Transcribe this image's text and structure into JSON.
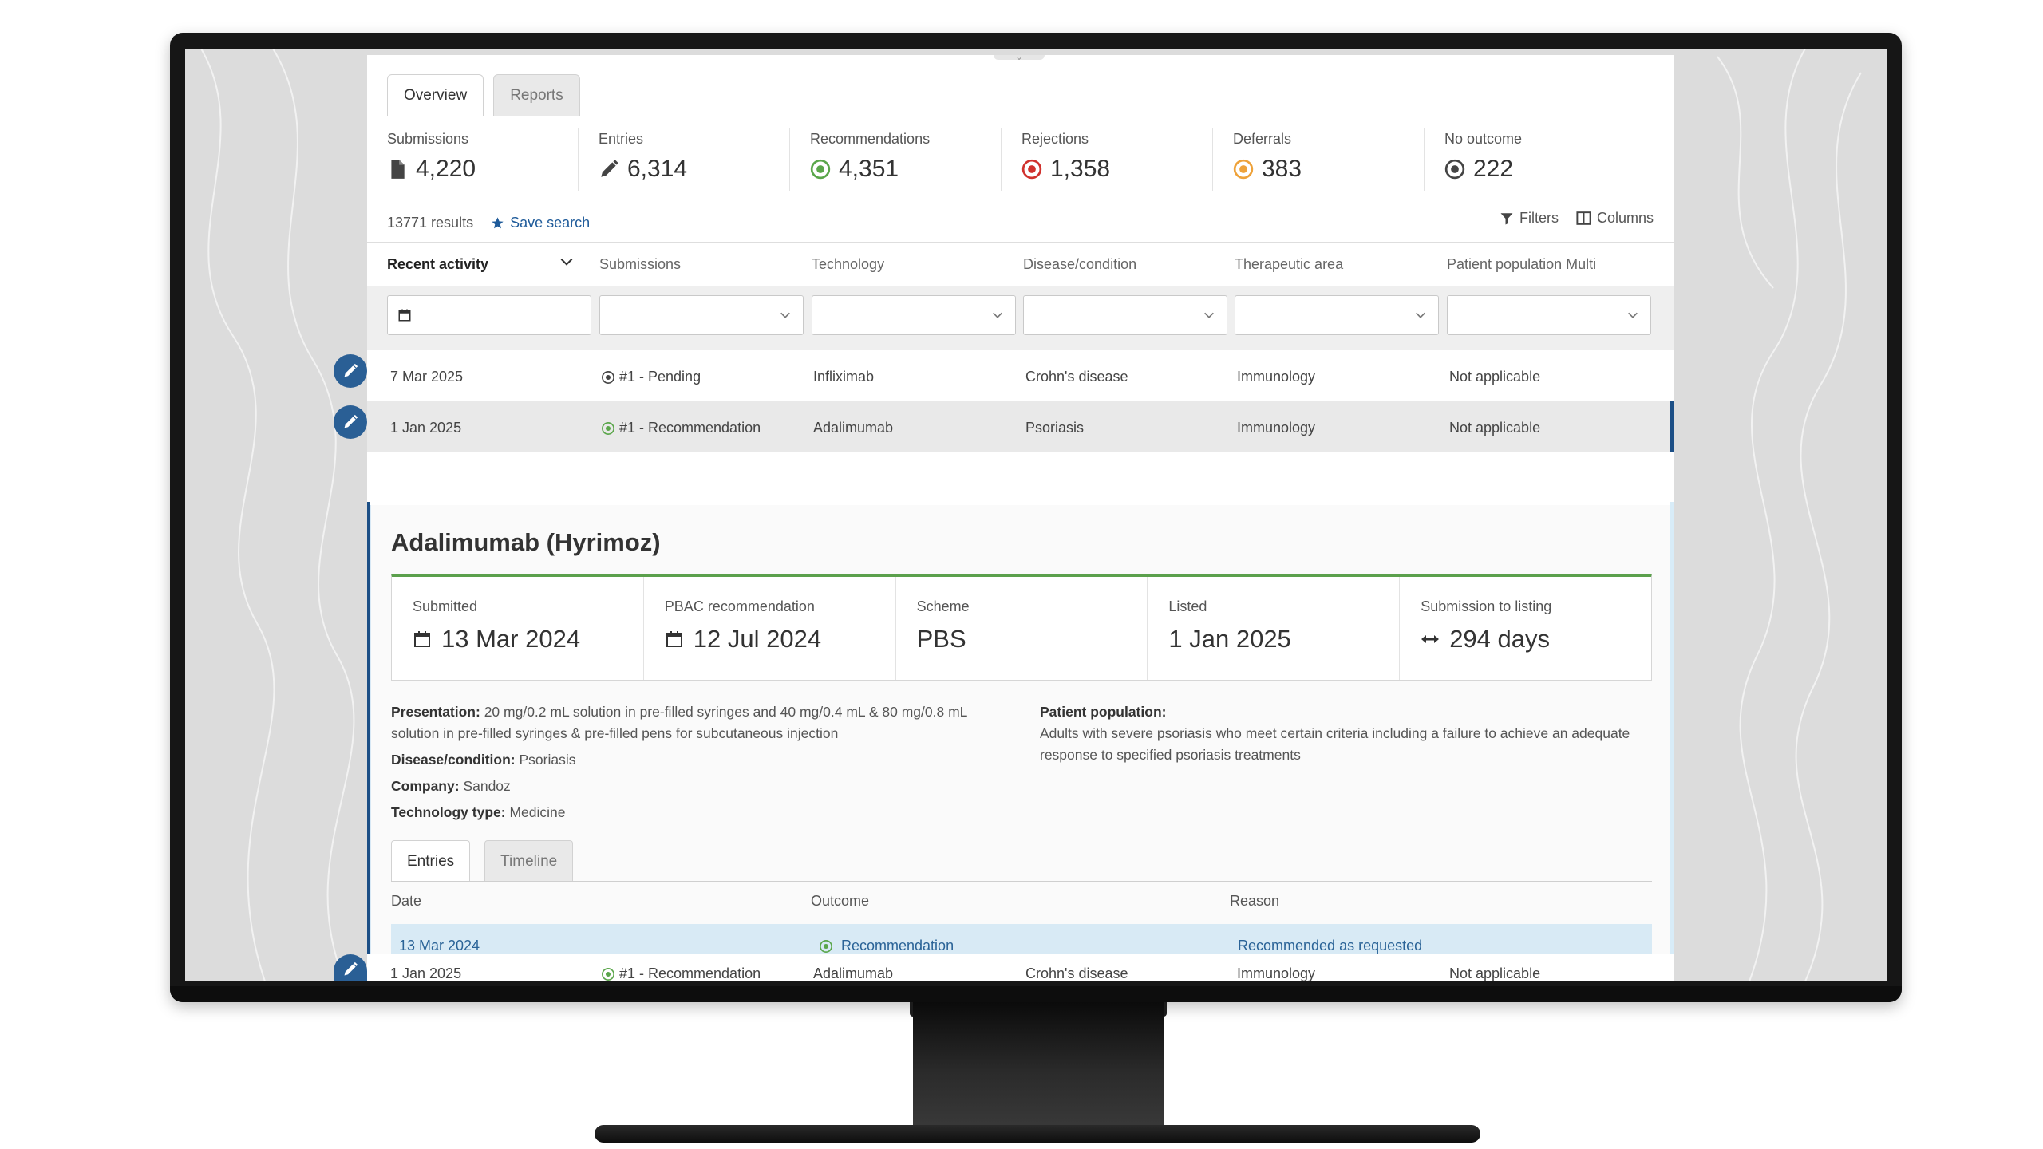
{
  "tabs": [
    {
      "label": "Overview",
      "active": true
    },
    {
      "label": "Reports",
      "active": false
    }
  ],
  "stats": [
    {
      "label": "Submissions",
      "value": "4,220",
      "icon": "document-icon",
      "color": "#444444"
    },
    {
      "label": "Entries",
      "value": "6,314",
      "icon": "pencil-icon",
      "color": "#444444"
    },
    {
      "label": "Recommendations",
      "value": "4,351",
      "icon": "recommendation-status-icon",
      "color": "#5aa64a"
    },
    {
      "label": "Rejections",
      "value": "1,358",
      "icon": "rejection-status-icon",
      "color": "#d0312d"
    },
    {
      "label": "Deferrals",
      "value": "383",
      "icon": "deferral-status-icon",
      "color": "#eea23a"
    },
    {
      "label": "No outcome",
      "value": "222",
      "icon": "no-outcome-status-icon",
      "color": "#444444"
    }
  ],
  "results": {
    "count_text": "13771 results",
    "save_search": "Save search"
  },
  "tools": {
    "filters": "Filters",
    "columns": "Columns"
  },
  "columns": [
    "Recent activity",
    "Submissions",
    "Technology",
    "Disease/condition",
    "Therapeutic area",
    "Patient population Multi"
  ],
  "rows": [
    {
      "date": "7 Mar 2025",
      "submission": "#1 - Pending",
      "status": "pending",
      "technology": "Infliximab",
      "disease": "Crohn's disease",
      "area": "Immunology",
      "population": "Not applicable"
    },
    {
      "date": "1 Jan 2025",
      "submission": "#1 - Recommendation",
      "status": "recommendation",
      "technology": "Adalimumab",
      "disease": "Psoriasis",
      "area": "Immunology",
      "population": "Not applicable"
    }
  ],
  "detail": {
    "title": "Adalimumab (Hyrimoz)",
    "cards": [
      {
        "label": "Submitted",
        "value": "13 Mar 2024",
        "icon": "calendar-icon"
      },
      {
        "label": "PBAC recommendation",
        "value": "12 Jul 2024",
        "icon": "calendar-icon"
      },
      {
        "label": "Scheme",
        "value": "PBS",
        "icon": ""
      },
      {
        "label": "Listed",
        "value": "1 Jan 2025",
        "icon": ""
      },
      {
        "label": "Submission to listing",
        "value": "294 days",
        "icon": "double-arrow-icon"
      }
    ],
    "presentation_label": "Presentation:",
    "presentation": "20 mg/0.2 mL solution in pre-filled syringes and 40 mg/0.4 mL & 80 mg/0.8 mL solution in pre-filled syringes & pre-filled pens for subcutaneous injection",
    "disease_label": "Disease/condition:",
    "disease": "Psoriasis",
    "company_label": "Company:",
    "company": "Sandoz",
    "techtype_label": "Technology type:",
    "techtype": "Medicine",
    "population_label": "Patient population:",
    "population": "Adults with severe psoriasis who meet certain criteria including a failure to achieve an adequate response to specified psoriasis treatments",
    "subtabs": [
      {
        "label": "Entries",
        "active": true
      },
      {
        "label": "Timeline",
        "active": false
      }
    ],
    "entries_headers": [
      "Date",
      "Outcome",
      "Reason"
    ],
    "entries": [
      {
        "date": "13 Mar 2024",
        "outcome": "Recommendation",
        "reason": "Recommended as requested"
      }
    ]
  },
  "bottom_row": {
    "date": "1 Jan 2025",
    "submission": "#1 - Recommendation",
    "technology": "Adalimumab",
    "disease": "Crohn's disease",
    "area": "Immunology",
    "population": "Not applicable"
  },
  "colors": {
    "accent": "#1f5b9a",
    "green": "#5aa64a",
    "red": "#d0312d",
    "orange": "#eea23a",
    "row_highlight": "#d8eaf5"
  }
}
